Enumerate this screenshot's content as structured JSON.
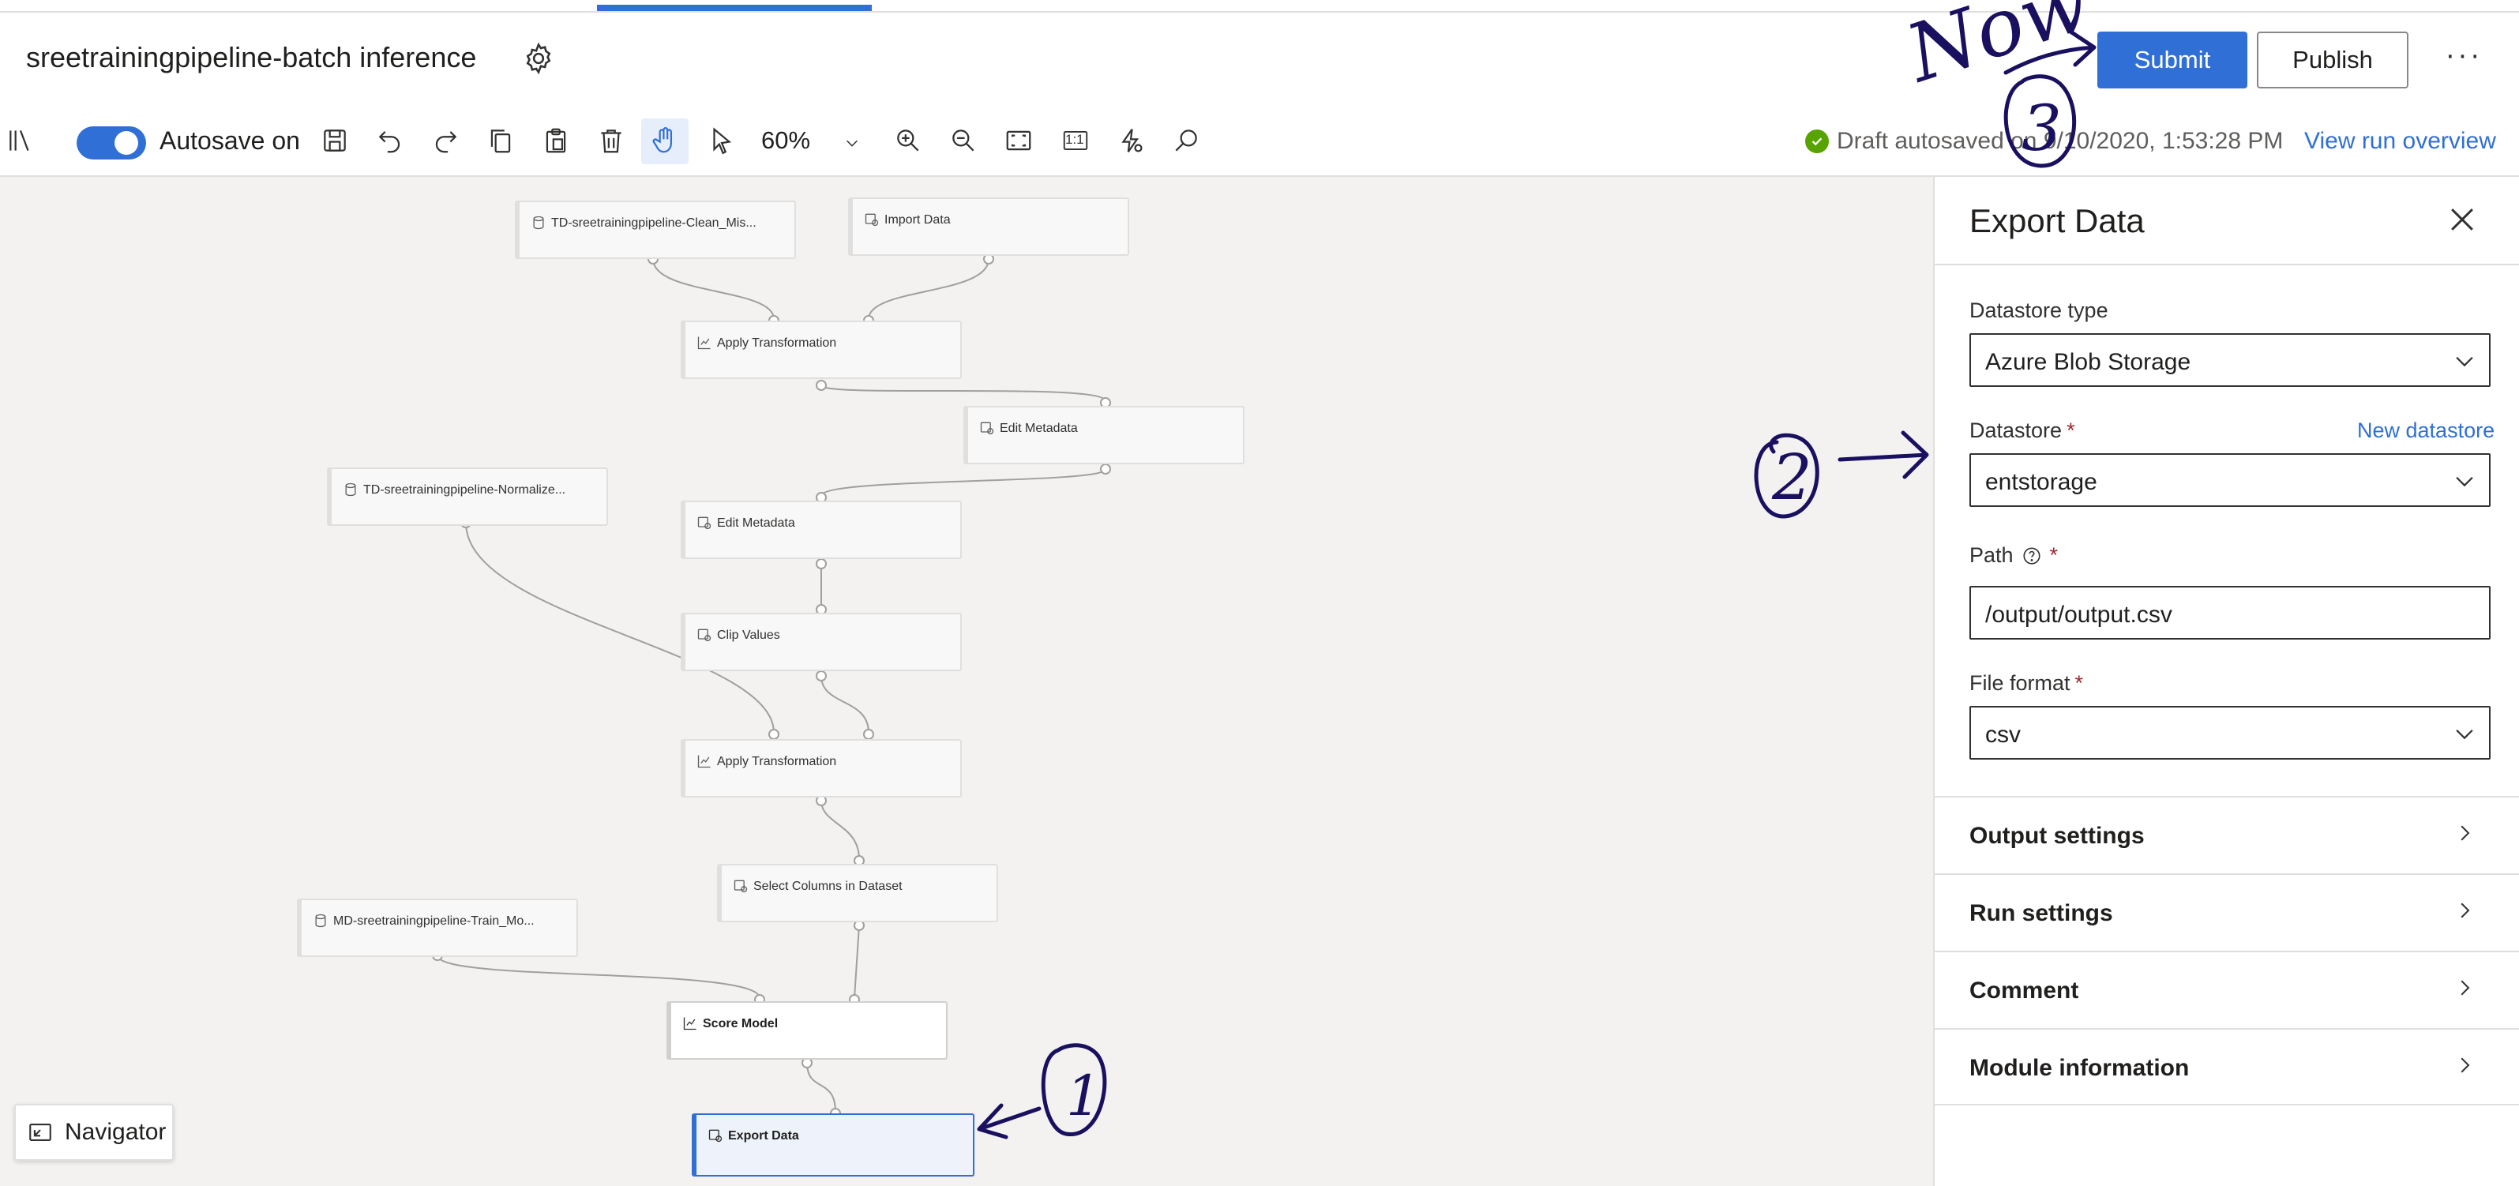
{
  "header": {
    "pipeline_title": "sreetrainingpipeline-batch inference",
    "submit_label": "Submit",
    "publish_label": "Publish",
    "more_label": "···"
  },
  "toolbar": {
    "autosave_label": "Autosave on",
    "autosave_enabled": true,
    "zoom_value": "60%",
    "actual_size_label": "1:1",
    "status_text": "Draft autosaved on 9/10/2020, 1:53:28 PM",
    "view_run_label": "View run overview",
    "icons": [
      "library-icon",
      "save-icon",
      "undo-icon",
      "redo-icon",
      "copy-icon",
      "paste-icon",
      "delete-icon",
      "hand-pan-icon",
      "pointer-select-icon",
      "zoom-in-icon",
      "zoom-out-icon",
      "fit-screen-icon",
      "actual-size-icon",
      "auto-layout-icon",
      "search-icon"
    ]
  },
  "canvas": {
    "modules": [
      {
        "label": "TD-sreetrainingpipeline-Clean_Mis...",
        "icon": "dataset-icon"
      },
      {
        "label": "Import Data",
        "icon": "module-icon"
      },
      {
        "label": "Apply Transformation",
        "icon": "chart-icon"
      },
      {
        "label": "Edit Metadata",
        "icon": "module-icon"
      },
      {
        "label": "TD-sreetrainingpipeline-Normalize...",
        "icon": "dataset-icon"
      },
      {
        "label": "Edit Metadata",
        "icon": "module-icon"
      },
      {
        "label": "Clip Values",
        "icon": "module-icon"
      },
      {
        "label": "Apply Transformation",
        "icon": "chart-icon"
      },
      {
        "label": "Select Columns in Dataset",
        "icon": "module-icon"
      },
      {
        "label": "MD-sreetrainingpipeline-Train_Mo...",
        "icon": "dataset-icon"
      },
      {
        "label": "Score Model",
        "icon": "chart-icon"
      },
      {
        "label": "Export Data",
        "icon": "module-icon",
        "selected": true
      }
    ],
    "navigator_label": "Navigator"
  },
  "panel": {
    "title": "Export Data",
    "datastore_type_label": "Datastore type",
    "datastore_type_value": "Azure Blob Storage",
    "datastore_label": "Datastore",
    "new_datastore_label": "New datastore",
    "datastore_value": "entstorage",
    "path_label": "Path",
    "path_value": "/output/output.csv",
    "file_format_label": "File format",
    "file_format_value": "csv",
    "required_mark": "*",
    "sections": [
      "Output settings",
      "Run settings",
      "Comment",
      "Module information"
    ]
  },
  "annotations": {
    "marker_1": "1",
    "marker_2": "2",
    "marker_3": "3",
    "now_text": "Now",
    "ink_color": "#1a1060"
  },
  "colors": {
    "accent": "#2f6fd6",
    "success": "#57a300",
    "required": "#a4262c",
    "canvas_bg": "#f3f2f1"
  }
}
